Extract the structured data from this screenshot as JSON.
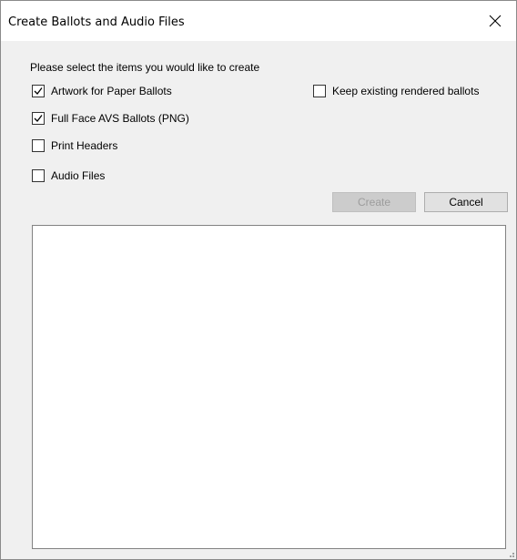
{
  "window": {
    "title": "Create Ballots and Audio Files",
    "close_icon": "close-icon"
  },
  "prompt": "Please select the items you would like to create",
  "options": [
    {
      "label": "Artwork for Paper Ballots",
      "checked": true
    },
    {
      "label": "Full Face AVS Ballots (PNG)",
      "checked": true
    },
    {
      "label": "Print Headers",
      "checked": false
    },
    {
      "label": "Audio Files",
      "checked": false
    }
  ],
  "keep_existing": {
    "label": "Keep existing rendered ballots",
    "checked": false
  },
  "buttons": {
    "create_label": "Create",
    "create_enabled": false,
    "cancel_label": "Cancel"
  },
  "output_box": {
    "text": ""
  }
}
